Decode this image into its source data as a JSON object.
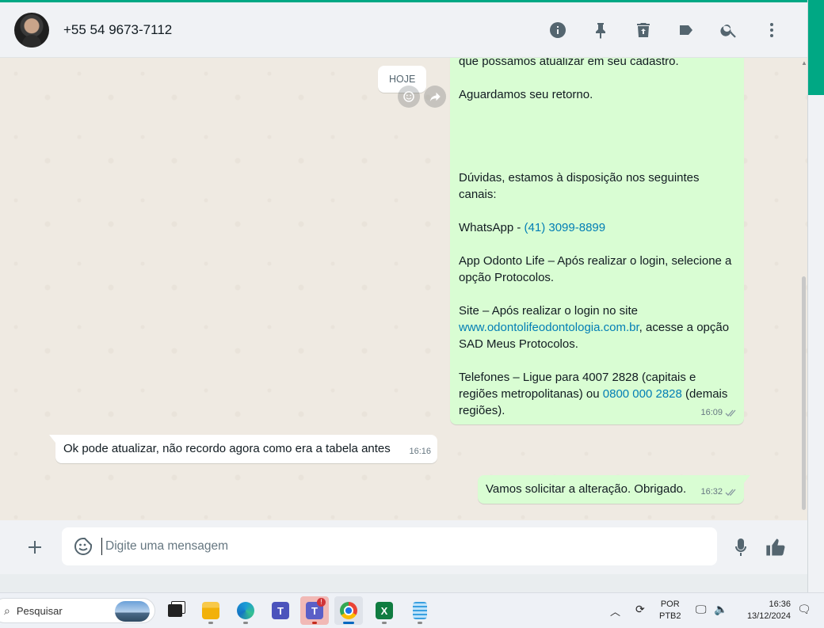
{
  "header": {
    "contact_name": "+55 54 9673-7112",
    "icons": [
      "info-icon",
      "pin-icon",
      "delete-icon",
      "label-icon",
      "search-icon",
      "menu-icon"
    ]
  },
  "chat": {
    "date_chip": "HOJE",
    "long_message": {
      "line_1": "que possamos atualizar em seu cadastro.",
      "line_2": "Aguardamos seu retorno.",
      "duvidas": "Dúvidas, estamos à disposição nos seguintes canais:",
      "whatsapp_prefix": "WhatsApp - ",
      "whatsapp_link": "(41) 3099-8899",
      "app": "App Odonto Life – Após realizar o login, selecione a opção Protocolos.",
      "site_prefix": "Site – Após realizar o login no site ",
      "site_link": "www.odontolifeodontologia.com.br",
      "site_suffix": ", acesse a opção SAD Meus Protocolos.",
      "tel_prefix": "Telefones – Ligue para 4007 2828 (capitais e regiões metropolitanas) ou ",
      "tel_link": "0800 000 2828",
      "tel_suffix": " (demais regiões).",
      "time": "16:09"
    },
    "incoming_message": {
      "text": "Ok pode atualizar, não recordo agora como era a tabela antes",
      "time": "16:16"
    },
    "outgoing_message": {
      "text": "Vamos solicitar a alteração. Obrigado.",
      "time": "16:32"
    }
  },
  "composer": {
    "placeholder": "Digite uma mensagem"
  },
  "taskbar": {
    "search_label": "Pesquisar",
    "lang_line1": "POR",
    "lang_line2": "PTB2",
    "time": "16:36",
    "date": "13/12/2024"
  }
}
